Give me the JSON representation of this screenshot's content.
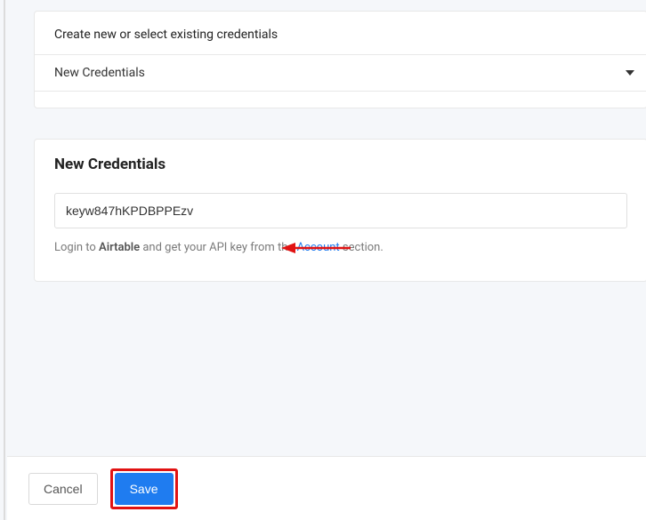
{
  "topCard": {
    "label": "Create new or select existing credentials",
    "selectedOption": "New Credentials"
  },
  "credentialsCard": {
    "title": "New Credentials",
    "apiKeyValue": "keyw847hKPDBPPEzv",
    "helper": {
      "prefix": "Login to ",
      "bold": "Airtable",
      "mid": " and get your API key from the ",
      "link": "Account",
      "suffix": " section."
    }
  },
  "footer": {
    "cancel": "Cancel",
    "save": "Save"
  }
}
